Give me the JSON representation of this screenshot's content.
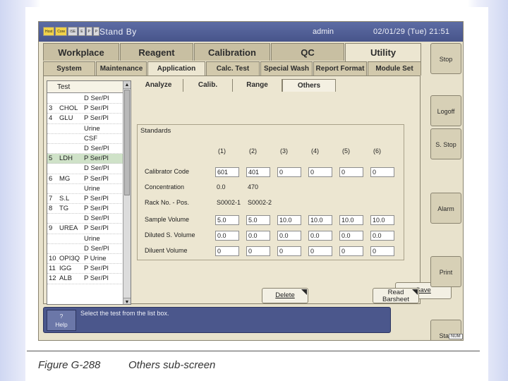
{
  "window": {
    "modules": [
      "Host",
      "Core",
      "ISE",
      "E",
      "P",
      "P"
    ],
    "status": "Stand By",
    "user": "admin",
    "datetime": "02/01/29 (Tue) 21:51"
  },
  "main_tabs": [
    "Workplace",
    "Reagent",
    "Calibration",
    "QC",
    "Utility"
  ],
  "active_main_tab": "Utility",
  "sub_tabs": [
    "System",
    "Maintenance",
    "Application",
    "Calc. Test",
    "Special Wash",
    "Report Format",
    "Module Set"
  ],
  "active_sub_tab": "Application",
  "inner_tabs": [
    "Analyze",
    "Calib.",
    "Range",
    "Others"
  ],
  "active_inner_tab": "Others",
  "test_list": {
    "header": "Test",
    "rows": [
      {
        "no": "",
        "name": "",
        "type": "D Ser/Pl"
      },
      {
        "no": "3",
        "name": "CHOL",
        "type": "P Ser/Pl"
      },
      {
        "no": "4",
        "name": "GLU",
        "type": "P Ser/Pl"
      },
      {
        "no": "",
        "name": "",
        "type": "Urine"
      },
      {
        "no": "",
        "name": "",
        "type": "CSF"
      },
      {
        "no": "",
        "name": "",
        "type": "D Ser/Pl"
      },
      {
        "no": "5",
        "name": "LDH",
        "type": "P Ser/Pl"
      },
      {
        "no": "",
        "name": "",
        "type": "D Ser/Pl"
      },
      {
        "no": "6",
        "name": "MG",
        "type": "P Ser/Pl"
      },
      {
        "no": "",
        "name": "",
        "type": "Urine"
      },
      {
        "no": "7",
        "name": "S.L",
        "type": "P Ser/Pl"
      },
      {
        "no": "8",
        "name": "TG",
        "type": "P Ser/Pl"
      },
      {
        "no": "",
        "name": "",
        "type": "D Ser/Pl"
      },
      {
        "no": "9",
        "name": "UREA",
        "type": "P Ser/Pl"
      },
      {
        "no": "",
        "name": "",
        "type": "Urine"
      },
      {
        "no": "",
        "name": "",
        "type": "D Ser/Pl"
      },
      {
        "no": "10",
        "name": "OPI3Q",
        "type": "P Urine"
      },
      {
        "no": "11",
        "name": "IGG",
        "type": "P Ser/Pl"
      },
      {
        "no": "12",
        "name": "ALB",
        "type": "P Ser/Pl"
      }
    ],
    "selected_index": 6
  },
  "standards": {
    "title": "Standards",
    "columns": [
      "(1)",
      "(2)",
      "(3)",
      "(4)",
      "(5)",
      "(6)"
    ],
    "rows": [
      {
        "label": "Calibrator Code",
        "values": [
          "601",
          "401",
          "0",
          "0",
          "0",
          "0"
        ]
      },
      {
        "label": "Concentration",
        "values": [
          "0.0",
          "470",
          "",
          "",
          "",
          ""
        ]
      },
      {
        "label": "Rack No. - Pos.",
        "values": [
          "S0002-1",
          "S0002-2",
          "",
          "",
          "",
          ""
        ]
      },
      {
        "label": "Sample Volume",
        "values": [
          "5.0",
          "5.0",
          "10.0",
          "10.0",
          "10.0",
          "10.0"
        ]
      },
      {
        "label": "Diluted S. Volume",
        "values": [
          "0.0",
          "0.0",
          "0.0",
          "0.0",
          "0.0",
          "0.0"
        ]
      },
      {
        "label": "Diluent Volume",
        "values": [
          "0",
          "0",
          "0",
          "0",
          "0",
          "0"
        ]
      }
    ]
  },
  "buttons": {
    "save": "Save",
    "delete": "Delete",
    "read_barsheet_1": "Read",
    "read_barsheet_2": "Barsheet"
  },
  "side_buttons": [
    "Stop",
    "Logoff",
    "S. Stop",
    "Alarm",
    "Print",
    "Start"
  ],
  "help": {
    "button_mark": "?",
    "button_label": "Help",
    "message": "Select the test from the list box."
  },
  "indicator": "NUM",
  "caption": {
    "figure": "Figure G-288",
    "title": "Others sub-screen"
  }
}
